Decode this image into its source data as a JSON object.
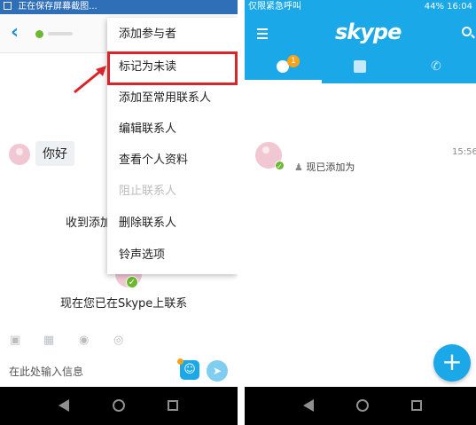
{
  "left": {
    "status_bar": {
      "text": "正在保存屏幕截图..."
    },
    "header": {
      "back_icon": "chevron-left-icon"
    },
    "messages": {
      "greeting_bubble": "你好",
      "received_text": "收到添加",
      "now_connected_text": "现在您已在Skype上联系"
    },
    "menu": {
      "items": [
        "添加参与者",
        "标记为未读",
        "添加至常用联系人",
        "编辑联系人",
        "查看个人资料",
        "阻止联系人",
        "删除联系人",
        "铃声选项"
      ],
      "highlighted_index": 1
    },
    "input": {
      "placeholder": "在此处输入信息"
    },
    "accent_color": "#1aa8e8",
    "highlight_color": "#d9242a"
  },
  "right": {
    "status_bar": {
      "left_text": "仅限紧急呼叫",
      "battery_text": "44%",
      "time_text": "16:04"
    },
    "header": {
      "logo_text": "skype",
      "tab_badge": "1"
    },
    "recent_item": {
      "time": "15:56",
      "subtitle": "现已添加为"
    },
    "fab_label": "+",
    "brand_color": "#1aa8e8"
  }
}
